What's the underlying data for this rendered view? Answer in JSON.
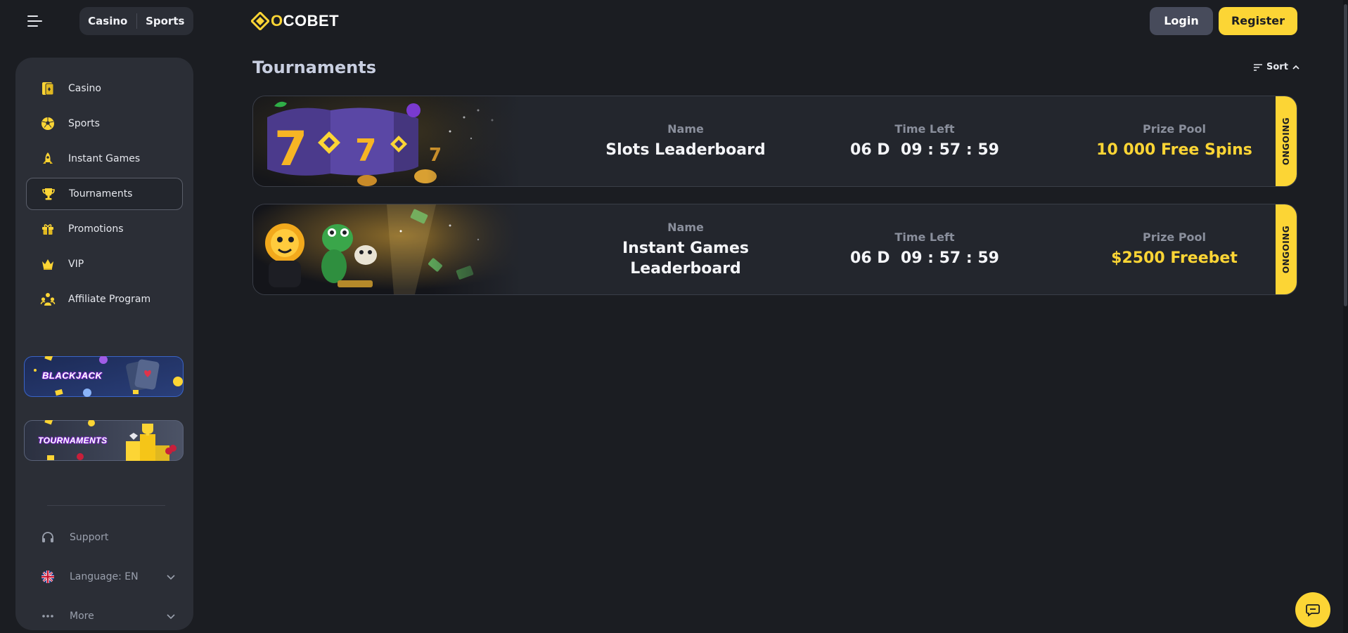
{
  "header": {
    "mode_tabs": [
      "Casino",
      "Sports"
    ],
    "logo_text_o": "O",
    "logo_text_rest": "COBET",
    "login_label": "Login",
    "register_label": "Register"
  },
  "sidebar": {
    "items": [
      {
        "label": "Casino",
        "icon": "casino-cards-icon",
        "active": false
      },
      {
        "label": "Sports",
        "icon": "soccer-ball-icon",
        "active": false
      },
      {
        "label": "Instant Games",
        "icon": "rocket-icon",
        "active": false
      },
      {
        "label": "Tournaments",
        "icon": "trophy-icon",
        "active": true
      },
      {
        "label": "Promotions",
        "icon": "gift-icon",
        "active": false
      },
      {
        "label": "VIP",
        "icon": "crown-icon",
        "active": false
      },
      {
        "label": "Affiliate Program",
        "icon": "affiliate-icon",
        "active": false
      }
    ],
    "banners": [
      {
        "title": "BLACKJACK"
      },
      {
        "title": "TOURNAMENTS"
      }
    ],
    "footer": {
      "support_label": "Support",
      "language_label": "Language: EN",
      "more_label": "More"
    }
  },
  "main": {
    "title": "Tournaments",
    "sort_label": "Sort",
    "column_labels": {
      "name": "Name",
      "time_left": "Time Left",
      "prize_pool": "Prize Pool"
    },
    "tournaments": [
      {
        "name": "Slots Leaderboard",
        "time_left": "06 D  09 : 57 : 59",
        "prize_pool": "10 000 Free Spins",
        "status": "ONGOING"
      },
      {
        "name": "Instant Games Leaderboard",
        "name_line1": "Instant Games",
        "name_line2": "Leaderboard",
        "time_left": "06 D  09 : 57 : 59",
        "prize_pool": "$2500 Freebet",
        "status": "ONGOING"
      }
    ]
  },
  "colors": {
    "accent": "#fcd535",
    "background": "#1b1d22",
    "panel": "#2b2e36",
    "card": "#23262d"
  }
}
